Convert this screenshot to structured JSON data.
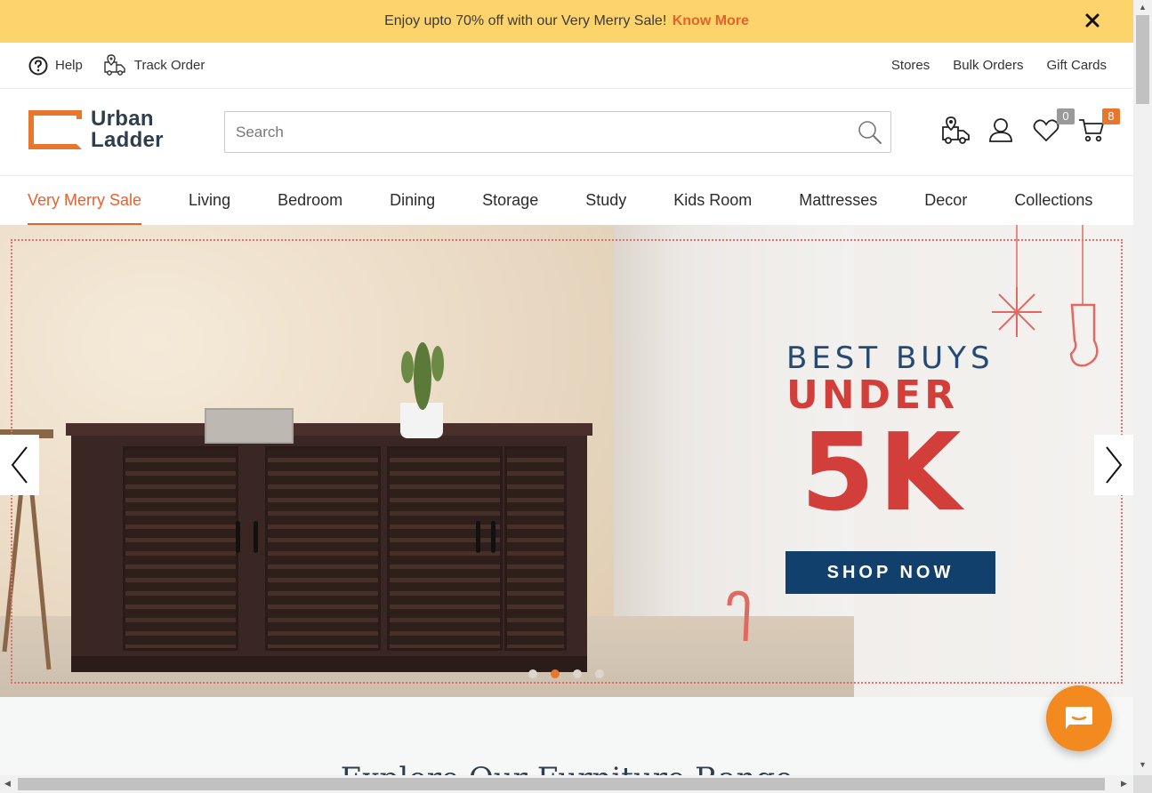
{
  "promo": {
    "text": "Enjoy upto 70% off with our Very Merry Sale!",
    "link": "Know More"
  },
  "utility": {
    "help": "Help",
    "track_order": "Track Order",
    "stores": "Stores",
    "bulk_orders": "Bulk Orders",
    "gift_cards": "Gift Cards"
  },
  "logo": {
    "line1": "Urban",
    "line2": "Ladder"
  },
  "search": {
    "placeholder": "Search",
    "value": ""
  },
  "header_icons": {
    "wishlist_count": "0",
    "cart_count": "8",
    "icons": [
      "truck-location-icon",
      "user-icon",
      "heart-icon",
      "cart-icon"
    ]
  },
  "nav": {
    "items": [
      "Very Merry Sale",
      "Living",
      "Bedroom",
      "Dining",
      "Storage",
      "Study",
      "Kids Room",
      "Mattresses",
      "Decor",
      "Collections"
    ],
    "active": "Very Merry Sale"
  },
  "hero": {
    "line1": "BEST BUYS",
    "line2": "UNDER",
    "line3": "5K",
    "cta": "SHOP NOW",
    "slide_count": 4,
    "active_slide": 2
  },
  "section": {
    "heading": "Explore Our Furniture Range"
  },
  "colors": {
    "promo_bg": "#fdd46b",
    "accent": "#e8602c",
    "logo_orange": "#e8772e",
    "hero_red": "#d23f3a",
    "hero_navy": "#12406d",
    "chat_orange": "#f28a1f"
  }
}
